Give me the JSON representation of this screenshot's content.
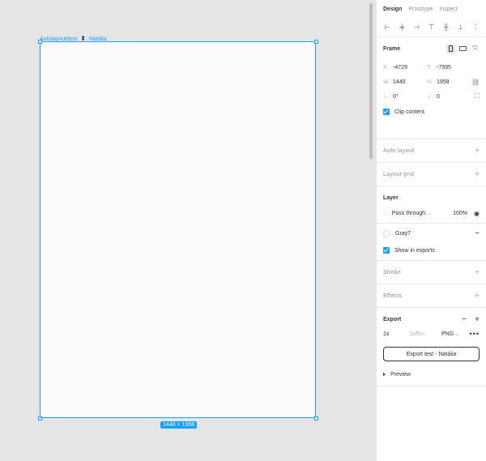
{
  "canvas": {
    "frame_label": "Autolayout/test",
    "frame_label_user": "Natália",
    "size_badge": "1440 × 1958"
  },
  "panel": {
    "tabs": [
      "Design",
      "Prototype",
      "Inspect"
    ],
    "frame": {
      "title": "Frame",
      "x_label": "X",
      "x_value": "-4729",
      "y_label": "Y",
      "y_value": "-7595",
      "w_label": "W",
      "w_value": "1440",
      "h_label": "H",
      "h_value": "1958",
      "rotation_value": "0°",
      "radius_value": "0",
      "clip_content": "Clip content"
    },
    "auto_layout": "Auto layout",
    "layout_grid": "Layout grid",
    "layer": {
      "title": "Layer",
      "blend_mode": "Pass through",
      "opacity": "100%"
    },
    "fill": {
      "name": "Gray7",
      "show_in_exports": "Show in exports"
    },
    "stroke": "Stroke",
    "effects": "Effects",
    "export": {
      "title": "Export",
      "scale": "1x",
      "suffix_placeholder": "Suffix",
      "format": "PNG",
      "button": "Export test - Natália",
      "preview": "Preview"
    },
    "colors": {
      "accent": "#18a0fb"
    }
  }
}
